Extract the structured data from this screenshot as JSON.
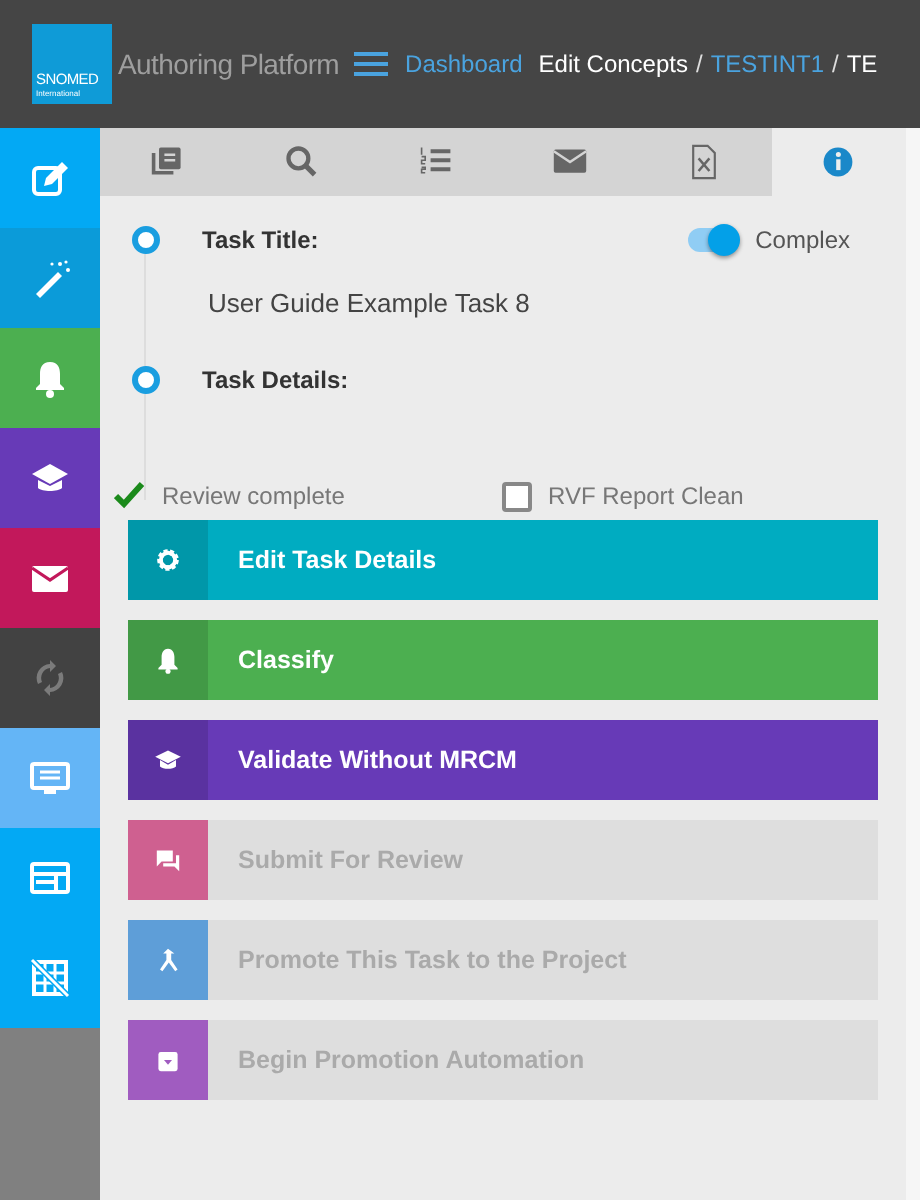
{
  "header": {
    "logo": {
      "line_1": "SNOMED",
      "line_2": "International"
    },
    "title": "Authoring Platform",
    "nav_link": "Dashboard",
    "breadcrumbs": [
      {
        "label": "Edit Concepts",
        "kind": "text"
      },
      {
        "label": "/",
        "kind": "separator"
      },
      {
        "label": "TESTINT1",
        "kind": "link"
      },
      {
        "label": "/",
        "kind": "separator"
      },
      {
        "label": "TE",
        "kind": "text"
      }
    ]
  },
  "sidebar": {
    "items": [
      {
        "color": "#03a9f4",
        "disabled": false
      },
      {
        "color": "#0b9bd9",
        "disabled": false
      },
      {
        "color": "#4caf50",
        "disabled": false
      },
      {
        "color": "#673ab7",
        "disabled": false
      },
      {
        "color": "#c2185b",
        "disabled": false
      },
      {
        "color": "#424242",
        "disabled": true
      },
      {
        "color": "#64b5f6",
        "disabled": false
      },
      {
        "color": "#03a9f4",
        "disabled": false
      },
      {
        "color": "#03a9f4",
        "disabled": false
      }
    ]
  },
  "tabs": [
    {
      "selected": false
    },
    {
      "selected": false
    },
    {
      "selected": false
    },
    {
      "selected": false
    },
    {
      "selected": false
    },
    {
      "selected": true
    }
  ],
  "task": {
    "title_label": "Task Title:",
    "title_value": "User Guide Example Task 8",
    "complex_toggle": {
      "label": "Complex",
      "on": true
    },
    "details_label": "Task Details:",
    "checks": [
      {
        "label": "Review complete",
        "checked": true,
        "kind": "tick"
      },
      {
        "label": "RVF Report Clean",
        "checked": false,
        "kind": "checkbox"
      }
    ]
  },
  "actions": [
    {
      "label": "Edit Task Details",
      "color": "#00acc1",
      "disabled": false
    },
    {
      "label": "Classify",
      "color": "#4caf50",
      "disabled": false
    },
    {
      "label": "Validate Without MRCM",
      "color": "#673ab7",
      "disabled": false
    },
    {
      "label": "Submit For Review",
      "color": "#cf6090",
      "disabled": true
    },
    {
      "label": "Promote This Task to the Project",
      "color": "#5e9ed8",
      "disabled": true
    },
    {
      "label": "Begin Promotion Automation",
      "color": "#a05cc0",
      "disabled": true
    }
  ]
}
